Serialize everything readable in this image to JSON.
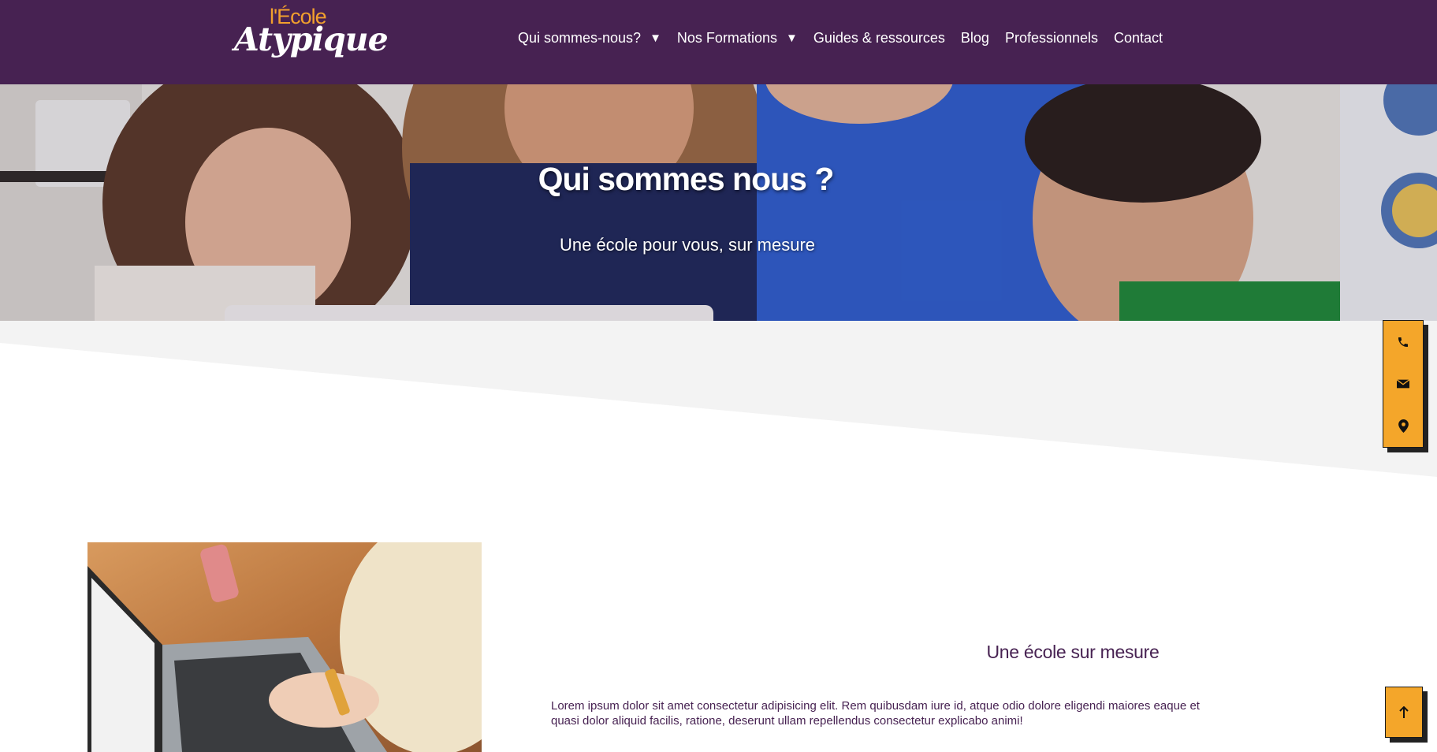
{
  "header": {
    "logo": {
      "small": "l'École",
      "big": "Atypique"
    },
    "nav": [
      {
        "label": "Qui sommes-nous?",
        "has_dropdown": true
      },
      {
        "label": "Nos Formations",
        "has_dropdown": true
      },
      {
        "label": "Guides & ressources",
        "has_dropdown": false
      },
      {
        "label": "Blog",
        "has_dropdown": false
      },
      {
        "label": "Professionnels",
        "has_dropdown": false
      },
      {
        "label": "Contact",
        "has_dropdown": false
      }
    ],
    "caret": "▼"
  },
  "hero": {
    "title": "Qui sommes nous ?",
    "subtitle": "Une école pour vous, sur mesure"
  },
  "float_bar": {
    "icons": [
      "phone-icon",
      "envelope-icon",
      "map-marker-icon"
    ]
  },
  "section": {
    "title": "Une école sur mesure",
    "text": "Lorem ipsum dolor sit amet consectetur adipisicing elit. Rem quibusdam iure id, atque odio dolore eligendi maiores eaque et quasi dolor aliquid facilis, ratione, deserunt ullam repellendus consectetur explicabo animi!"
  },
  "back_to_top_icon": "arrow-up-icon",
  "colors": {
    "brand_purple": "#472252",
    "accent_orange": "#f4a62a",
    "logo_orange": "#f2a02d"
  }
}
